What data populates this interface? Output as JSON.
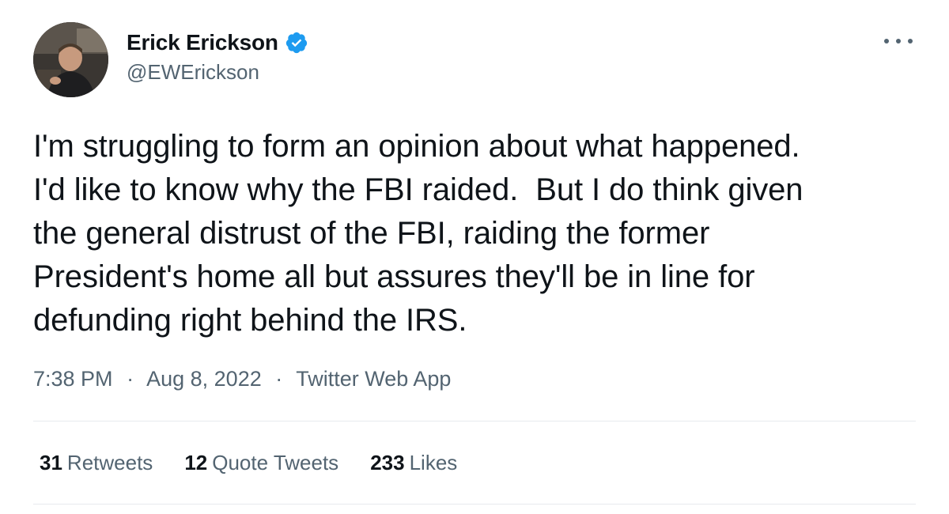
{
  "author": {
    "name": "Erick Erickson",
    "handle": "@EWErickson",
    "verified": true,
    "verified_color": "#1d9bf0"
  },
  "tweet": {
    "text": "I'm struggling to form an opinion about what happened.\nI'd like to know why the FBI raided.  But I do think given\nthe general distrust of the FBI, raiding the former\nPresident's home all but assures they'll be in line for\ndefunding right behind the IRS.",
    "time": "7:38 PM",
    "separator": "·",
    "date": "Aug 8, 2022",
    "client": "Twitter Web App"
  },
  "stats": {
    "retweets_count": "31",
    "retweets_label": "Retweets",
    "quotes_count": "12",
    "quotes_label": "Quote Tweets",
    "likes_count": "233",
    "likes_label": "Likes"
  },
  "icons": {
    "verified": "verified-badge-icon",
    "more": "more-horizontal-icon",
    "avatar": "profile-photo"
  }
}
